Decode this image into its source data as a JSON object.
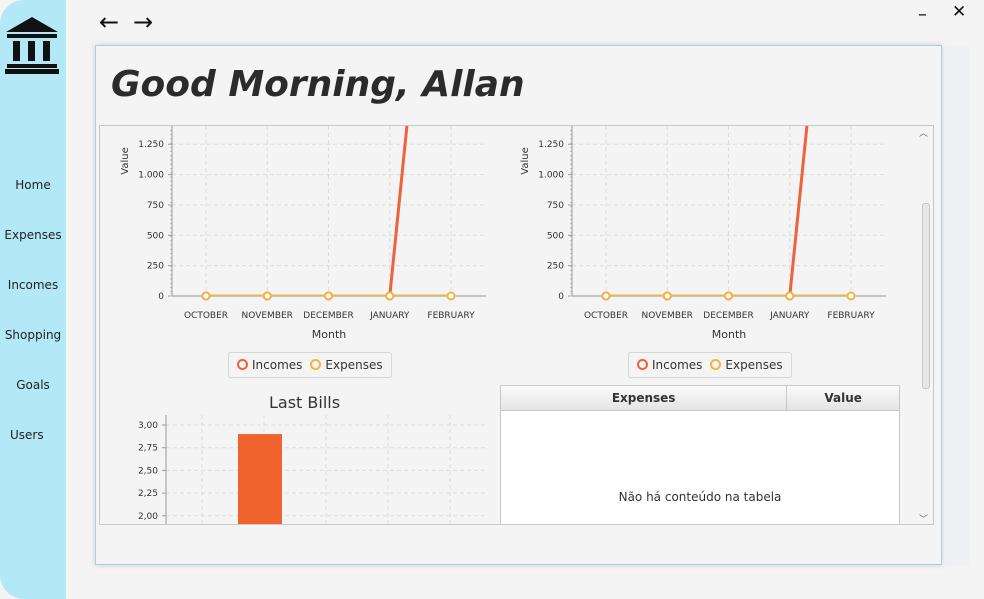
{
  "window": {
    "back_icon": "←",
    "forward_icon": "→",
    "minimize_icon": "–",
    "close_icon": "✕"
  },
  "sidebar": {
    "logo": "bank-icon",
    "items": [
      {
        "label": "Home"
      },
      {
        "label": "Expenses"
      },
      {
        "label": "Incomes"
      },
      {
        "label": "Shopping"
      },
      {
        "label": "Goals"
      },
      {
        "label": "Users"
      }
    ]
  },
  "main": {
    "greeting": "Good Morning, Allan"
  },
  "charts": {
    "legend": {
      "incomes": "Incomes",
      "expenses": "Expenses"
    },
    "bills_title": "Last Bills"
  },
  "table": {
    "columns": [
      "Expenses",
      "Value"
    ],
    "empty_text": "Não há conteúdo na tabela"
  },
  "colors": {
    "incomes": "#f0623a",
    "expenses": "#f2b442",
    "sidebar": "#b3e8f7",
    "bar": "#f0622e"
  },
  "chart_data": [
    {
      "type": "line",
      "x": [
        "OCTOBER",
        "NOVEMBER",
        "DECEMBER",
        "JANUARY",
        "FEBRUARY"
      ],
      "xlabel": "Month",
      "ylabel": "Value",
      "yticks": [
        0,
        250,
        500,
        750,
        "1.000",
        "1.250"
      ],
      "ylim": [
        0,
        1400
      ],
      "series": [
        {
          "name": "Incomes",
          "values": [
            0,
            0,
            0,
            0,
            5000
          ]
        },
        {
          "name": "Expenses",
          "values": [
            0,
            0,
            0,
            0,
            0
          ]
        }
      ],
      "grid": true,
      "legend": "bottom"
    },
    {
      "type": "line",
      "x": [
        "OCTOBER",
        "NOVEMBER",
        "DECEMBER",
        "JANUARY",
        "FEBRUARY"
      ],
      "xlabel": "Month",
      "ylabel": "Value",
      "yticks": [
        0,
        250,
        500,
        750,
        "1.000",
        "1.250"
      ],
      "ylim": [
        0,
        1400
      ],
      "series": [
        {
          "name": "Incomes",
          "values": [
            0,
            0,
            0,
            0,
            5000
          ]
        },
        {
          "name": "Expenses",
          "values": [
            0,
            0,
            0,
            0,
            0
          ]
        }
      ],
      "grid": true,
      "legend": "bottom"
    },
    {
      "type": "bar",
      "title": "Last Bills",
      "yticks": [
        "2,00",
        "2,25",
        "2,50",
        "2,75",
        "3,00"
      ],
      "ylim": [
        2.0,
        3.0
      ],
      "values": [
        2.9
      ],
      "grid": true
    }
  ]
}
